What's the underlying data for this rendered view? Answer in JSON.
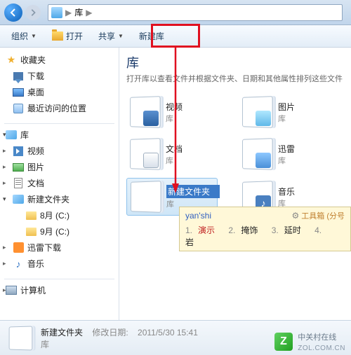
{
  "address": {
    "root": "库",
    "sep": "▶"
  },
  "toolbar": {
    "organize": "组织",
    "open": "打开",
    "share": "共享",
    "newlib": "新建库"
  },
  "sidebar": {
    "favorites": {
      "label": "收藏夹",
      "items": [
        "下载",
        "桌面",
        "最近访问的位置"
      ]
    },
    "libraries": {
      "label": "库",
      "items": [
        "视频",
        "图片",
        "文档",
        "新建文件夹",
        "迅雷下载",
        "音乐"
      ],
      "subfolders": [
        "8月 (C:)",
        "9月 (C:)"
      ]
    },
    "computer": "计算机"
  },
  "main": {
    "title": "库",
    "subtitle": "打开库以查看文件并根据文件夹、日期和其他属性排列这些文件",
    "subtype": "库",
    "items": {
      "video": "视频",
      "docs": "文档",
      "pics": "图片",
      "xunlei": "迅雷",
      "music": "音乐",
      "newfolder_edit": "新建文件夹"
    }
  },
  "ime": {
    "input": "yan'shi",
    "toolbox": "工具箱 (分号",
    "candidates": [
      {
        "n": "1.",
        "w": "演示"
      },
      {
        "n": "2.",
        "w": "掩饰"
      },
      {
        "n": "3.",
        "w": "延时"
      },
      {
        "n": "4.",
        "w": "岩"
      }
    ]
  },
  "status": {
    "name": "新建文件夹",
    "modlabel": "修改日期:",
    "modval": "2011/5/30 15:41",
    "type": "库"
  },
  "watermark": {
    "line1": "中关村在线",
    "line2": "ZOL.COM.CN"
  }
}
